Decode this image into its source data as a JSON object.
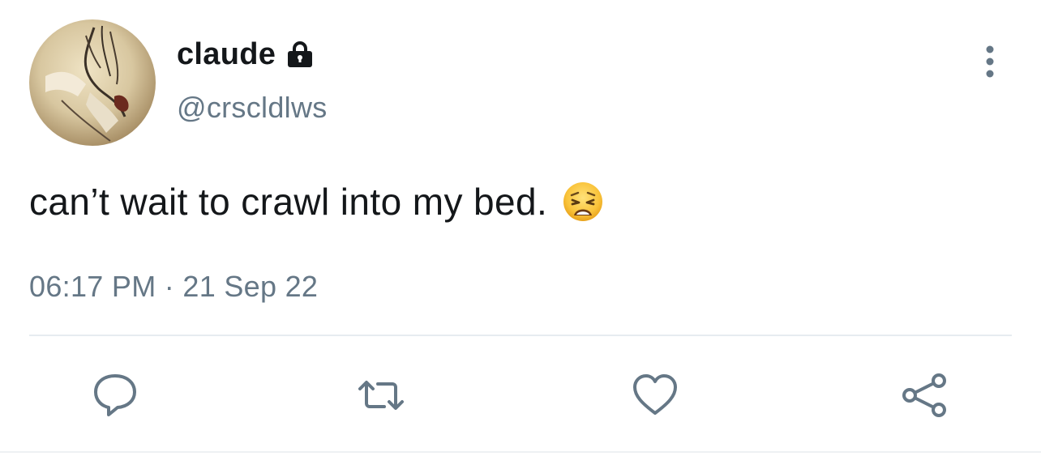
{
  "tweet": {
    "user": {
      "display_name": "claude",
      "handle": "@crscldlws",
      "protected_icon": "lock-icon",
      "avatar_icon": "avatar"
    },
    "text": "can’t wait to crawl into my bed.",
    "emoji": "weary-face",
    "timestamp": "06:17 PM · 21 Sep 22"
  },
  "actions": [
    {
      "name": "reply",
      "icon": "speech-bubble-icon"
    },
    {
      "name": "retweet",
      "icon": "retweet-icon"
    },
    {
      "name": "like",
      "icon": "heart-icon"
    },
    {
      "name": "share",
      "icon": "share-icon"
    }
  ],
  "menu": {
    "icon": "more-vertical-icon"
  },
  "colors": {
    "text": "#14171a",
    "secondary": "#657786",
    "divider": "#e6ecf0"
  }
}
